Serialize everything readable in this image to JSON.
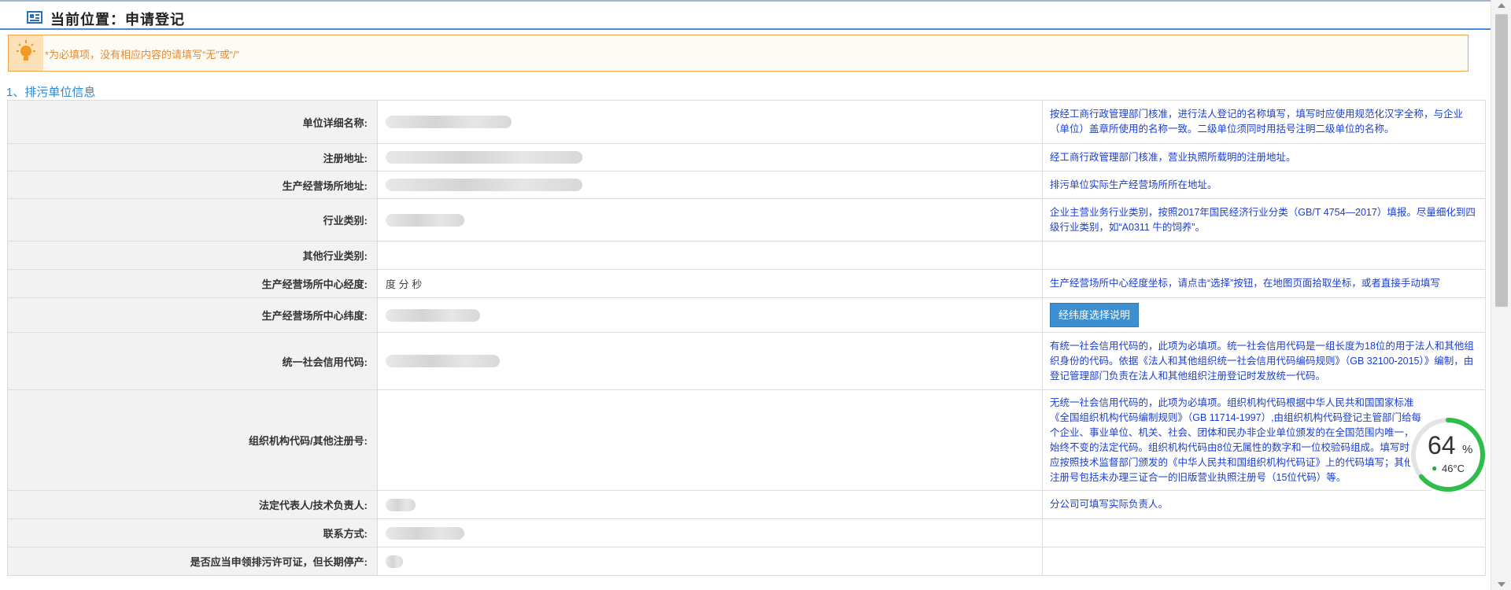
{
  "header": {
    "title": "当前位置：申请登记",
    "icon": "document-list-icon"
  },
  "notice": {
    "text": "*为必填项，没有相应内容的请填写“无”或“/”",
    "icon": "lightbulb-icon",
    "color": "#e98a2c"
  },
  "section": {
    "title": "1、排污单位信息"
  },
  "rows": [
    {
      "label": "单位详细名称:",
      "tip": "按经工商行政管理部门核准，进行法人登记的名称填写，填写时应使用规范化汉字全称，与企业（单位）盖章所使用的名称一致。二级单位须同时用括号注明二级单位的名称。"
    },
    {
      "label": "注册地址:",
      "tip": "经工商行政管理部门核准，营业执照所载明的注册地址。"
    },
    {
      "label": "生产经营场所地址:",
      "tip": "排污单位实际生产经营场所所在地址。"
    },
    {
      "label": "行业类别:",
      "tip": "企业主营业务行业类别，按照2017年国民经济行业分类（GB/T 4754—2017）填报。尽量细化到四级行业类别，如“A0311 牛的饲养”。"
    },
    {
      "label": "其他行业类别:",
      "tip": ""
    },
    {
      "label": "生产经营场所中心经度:",
      "value": "度 分 秒",
      "tip": "生产经营场所中心经度坐标，请点击“选择”按钮，在地图页面拾取坐标，或者直接手动填写"
    },
    {
      "label": "生产经营场所中心纬度:",
      "button": "经纬度选择说明"
    },
    {
      "label": "统一社会信用代码:",
      "tip": "有统一社会信用代码的，此项为必填项。统一社会信用代码是一组长度为18位的用于法人和其他组织身份的代码。依据《法人和其他组织统一社会信用代码编码规则》（GB 32100-2015）》编制，由登记管理部门负责在法人和其他组织注册登记时发放统一代码。"
    },
    {
      "label": "组织机构代码/其他注册号:",
      "tip": "无统一社会信用代码的，此项为必填项。组织机构代码根据中华人民共和国国家标准《全国组织机构代码编制规则》（GB 11714-1997）,由组织机构代码登记主管部门给每个企业、事业单位、机关、社会、团体和民办非企业单位颁发的在全国范围内唯一，始终不变的法定代码。组织机构代码由8位无属性的数字和一位校验码组成。填写时，应按照技术监督部门颁发的《中华人民共和国组织机构代码证》上的代码填写；其他注册号包括未办理三证合一的旧版营业执照注册号（15位代码）等。"
    },
    {
      "label": "法定代表人/技术负责人:",
      "tip": "分公司可填写实际负责人。"
    },
    {
      "label": "联系方式:",
      "tip": ""
    },
    {
      "label": "是否应当申领排污许可证，但长期停产:",
      "tip": ""
    }
  ],
  "gauge": {
    "percent": "64",
    "percent_sign": "%",
    "temperature": "46°C",
    "level": 0.64,
    "color": "#2ebd4a"
  },
  "colors": {
    "accent": "#2f86cf",
    "tip_text": "#1c3ecf",
    "button": "#3c8fd0"
  }
}
